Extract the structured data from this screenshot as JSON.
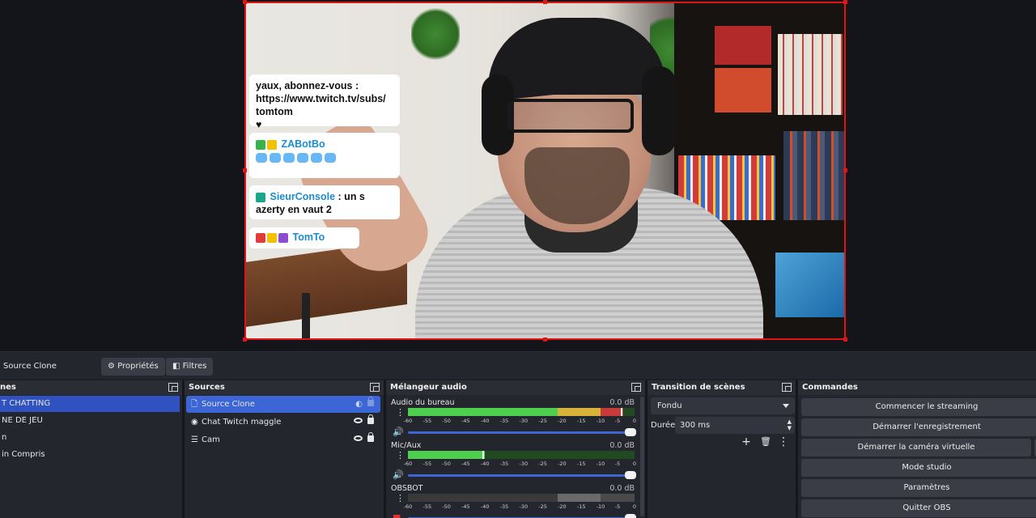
{
  "preview": {
    "chat_messages": [
      {
        "text": "yaux, abonnez-vous : https://www.twitch.tv/subs/ tomtom",
        "suffix": "♥"
      },
      {
        "name": "ZABotBo"
      },
      {
        "name": "SieurConsole",
        "text": ": un s azerty en vaut 2"
      },
      {
        "name": "TomTo"
      }
    ]
  },
  "context_bar": {
    "source_name": "Source Clone",
    "properties_label": "Propriétés",
    "filters_label": "Filtres"
  },
  "scenes": {
    "items": [
      {
        "label": "T CHATTING",
        "selected": true
      },
      {
        "label": "NE DE JEU"
      },
      {
        "label": "n"
      },
      {
        "label": "in Compris"
      }
    ],
    "title": "nes"
  },
  "sources": {
    "title": "Sources",
    "items": [
      {
        "label": "Source Clone",
        "icon": "clone-icon",
        "selected": true
      },
      {
        "label": "Chat Twitch maggle",
        "icon": "browser-icon"
      },
      {
        "label": "Cam",
        "icon": "list-icon"
      }
    ]
  },
  "mixer": {
    "title": "Mélangeur audio",
    "ticks": [
      "-60",
      "-55",
      "-50",
      "-45",
      "-40",
      "-35",
      "-30",
      "-25",
      "-20",
      "-15",
      "-10",
      "-5",
      "0"
    ],
    "channels": [
      {
        "name": "Audio du bureau",
        "db": "0.0 dB",
        "level": 0.95
      },
      {
        "name": "Mic/Aux",
        "db": "0.0 dB",
        "level": 0.34
      },
      {
        "name": "OBSBOT",
        "db": "0.0 dB",
        "level": 0.0
      }
    ]
  },
  "transitions": {
    "title": "Transition de scènes",
    "selected": "Fondu",
    "duration_label": "Durée",
    "duration_value": "300 ms",
    "add_label": "+",
    "delete_label": "🗑",
    "more_label": "⋮"
  },
  "commands": {
    "title": "Commandes",
    "buttons": [
      "Commencer le streaming",
      "Démarrer l'enregistrement",
      "Démarrer la caméra virtuelle",
      "Mode studio",
      "Paramètres",
      "Quitter OBS"
    ]
  },
  "colors": {
    "selection": "#2f52c0",
    "source_selection": "#3c66d6",
    "preview_border": "#e01515",
    "meter_green": "#4fcf4f",
    "meter_yellow": "#d8b33a",
    "meter_red": "#c93a3a"
  }
}
